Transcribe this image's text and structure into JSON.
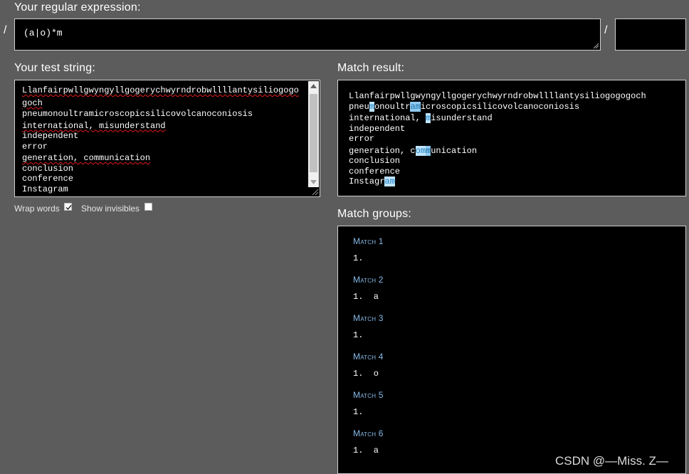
{
  "regex": {
    "label": "Your regular expression:",
    "open_delim": "/",
    "close_delim": "/",
    "pattern": "(a|o)*m",
    "flags": ""
  },
  "test": {
    "label": "Your test string:",
    "lines": [
      "Llanfairpwllgwyngyllgogerychwyrndrobwllllantysiliogogo",
      "goch",
      "pneumonoultramicroscopicsilicovolcanoconiosis",
      "international, misunderstand",
      "independent",
      "error",
      "generation, communication",
      "conclusion",
      "conference",
      "Instagram"
    ]
  },
  "options": {
    "wrap_label": "Wrap words",
    "wrap_checked": true,
    "invisibles_label": "Show invisibles",
    "invisibles_checked": false
  },
  "result": {
    "label": "Match result:",
    "lines": [
      {
        "pre": "Llanfairpwllgwyngyllgogerychwyrndrobwllllantysiliogogogoch",
        "m1": "",
        "mid": "",
        "m2": "",
        "post": ""
      },
      {
        "pre": "pneu",
        "m1": "m",
        "mid": "onoultr",
        "m2": "am",
        "post": "icroscopicsilicovolcanoconiosis"
      },
      {
        "pre": "international, ",
        "m1": "m",
        "mid": "isunderstand",
        "m2": "",
        "post": ""
      },
      {
        "pre": "independent",
        "m1": "",
        "mid": "",
        "m2": "",
        "post": ""
      },
      {
        "pre": "error",
        "m1": "",
        "mid": "",
        "m2": "",
        "post": ""
      },
      {
        "pre": "generation, c",
        "m1": "om",
        "mid": "",
        "m2": "m",
        "post": "unication"
      },
      {
        "pre": "conclusion",
        "m1": "",
        "mid": "",
        "m2": "",
        "post": ""
      },
      {
        "pre": "conference",
        "m1": "",
        "mid": "",
        "m2": "",
        "post": ""
      },
      {
        "pre": "Instagr",
        "m1": "am",
        "mid": "",
        "m2": "",
        "post": ""
      }
    ]
  },
  "groups": {
    "label": "Match groups:",
    "matches": [
      {
        "title": "Match 1",
        "item": "1.  "
      },
      {
        "title": "Match 2",
        "item": "1.  a"
      },
      {
        "title": "Match 3",
        "item": "1.  "
      },
      {
        "title": "Match 4",
        "item": "1.  o"
      },
      {
        "title": "Match 5",
        "item": "1.  "
      },
      {
        "title": "Match 6",
        "item": "1.  a"
      }
    ]
  },
  "watermark": "CSDN @—Miss. Z—"
}
